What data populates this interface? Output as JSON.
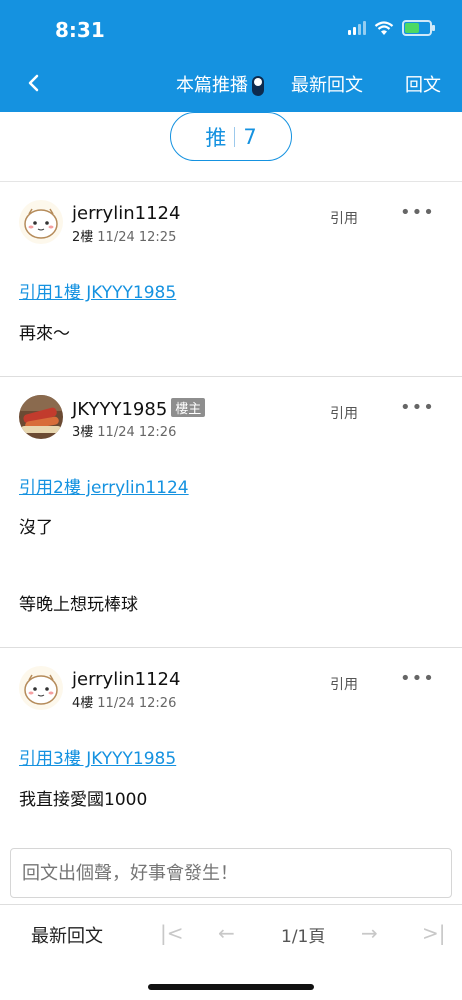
{
  "status": {
    "time": "8:31"
  },
  "nav": {
    "back_icon": "chevron-left-icon",
    "live_label": "本篇推播",
    "latest_label": "最新回文",
    "reply_label": "回文"
  },
  "push": {
    "label": "推",
    "count": "7"
  },
  "posts": [
    {
      "username": "jerrylin1124",
      "floor": "2樓",
      "time": "11/24 12:25",
      "quote_btn": "引用",
      "more": "•••",
      "quote_link": "引用1樓 JKYYY1985",
      "lines": [
        "再來～"
      ]
    },
    {
      "username": "JKYYY1985",
      "badge": "樓主",
      "floor": "3樓",
      "time": "11/24 12:26",
      "quote_btn": "引用",
      "more": "•••",
      "quote_link": "引用2樓 jerrylin1124",
      "lines": [
        "沒了",
        "等晚上想玩棒球"
      ]
    },
    {
      "username": "jerrylin1124",
      "floor": "4樓",
      "time": "11/24 12:26",
      "quote_btn": "引用",
      "more": "•••",
      "quote_link": "引用3樓 JKYYY1985",
      "lines": [
        "我直接愛國1000"
      ]
    }
  ],
  "reply": {
    "placeholder": "回文出個聲，好事會發生！"
  },
  "footer": {
    "latest_label": "最新回文",
    "first_icon": "|<",
    "prev_icon": "←",
    "page": "1/1頁",
    "next_icon": "→",
    "last_icon": ">|"
  },
  "colors": {
    "brand": "#1592e0",
    "badge": "#8e8e8e"
  }
}
